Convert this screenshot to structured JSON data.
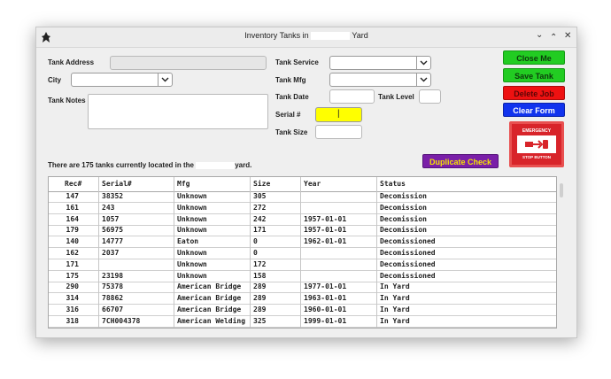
{
  "window": {
    "title_prefix": "Inventory Tanks in ",
    "title_suffix": " Yard",
    "controls": {
      "close": "✕",
      "minimize": "⌄",
      "maximize": "⌃"
    }
  },
  "form": {
    "tank_address_label": "Tank Address",
    "city_label": "City",
    "tank_notes_label": "Tank Notes",
    "tank_service_label": "Tank Service",
    "tank_mfg_label": "Tank Mfg",
    "tank_date_label": "Tank Date",
    "tank_level_label": "Tank Level",
    "serial_label": "Serial #",
    "tank_size_label": "Tank Size",
    "serial_value": "|",
    "colors": {
      "serial_highlight": "#ffff00"
    }
  },
  "buttons": {
    "close_me": "Close Me",
    "save_tank": "Save Tank",
    "delete_job": "Delete Job",
    "clear_form": "Clear Form",
    "duplicate_check": "Duplicate Check",
    "emergency_title": "EMERGENCY",
    "emergency_sub": "STOP BUTTON",
    "colors": {
      "close_me": "#22cc22",
      "save_tank": "#22cc22",
      "delete_job": "#ee1111",
      "clear_form": "#1133ee",
      "duplicate_check": "#7a1fa8",
      "emergency": "#d8242a"
    }
  },
  "status": {
    "prefix": "There are 175 tanks currently located in the ",
    "suffix": "yard."
  },
  "table": {
    "columns": [
      "Rec#",
      "Serial#",
      "Mfg",
      "Size",
      "Year",
      "Status"
    ],
    "rows": [
      [
        "147",
        "38352",
        "Unknown",
        "305",
        "",
        "Decomission"
      ],
      [
        "161",
        "243",
        "Unknown",
        "272",
        "",
        "Decomission"
      ],
      [
        "164",
        "1057",
        "Unknown",
        "242",
        "1957-01-01",
        "Decomission"
      ],
      [
        "179",
        "56975",
        "Unknown",
        "171",
        "1957-01-01",
        "Decomission"
      ],
      [
        "140",
        "14777",
        "Eaton",
        "0",
        "1962-01-01",
        "Decomissioned"
      ],
      [
        "162",
        "2037",
        "Unknown",
        "0",
        "",
        "Decomissioned"
      ],
      [
        "171",
        "",
        "Unknown",
        "172",
        "",
        "Decomissioned"
      ],
      [
        "175",
        "23198",
        "Unknown",
        "158",
        "",
        "Decomissioned"
      ],
      [
        "290",
        "75378",
        "American Bridge",
        "289",
        "1977-01-01",
        "In Yard"
      ],
      [
        "314",
        "78862",
        "American Bridge",
        "289",
        "1963-01-01",
        "In Yard"
      ],
      [
        "316",
        "66707",
        "American Bridge",
        "289",
        "1960-01-01",
        "In Yard"
      ],
      [
        "318",
        "7CH004378",
        "American Welding",
        "325",
        "1999-01-01",
        "In Yard"
      ]
    ]
  }
}
